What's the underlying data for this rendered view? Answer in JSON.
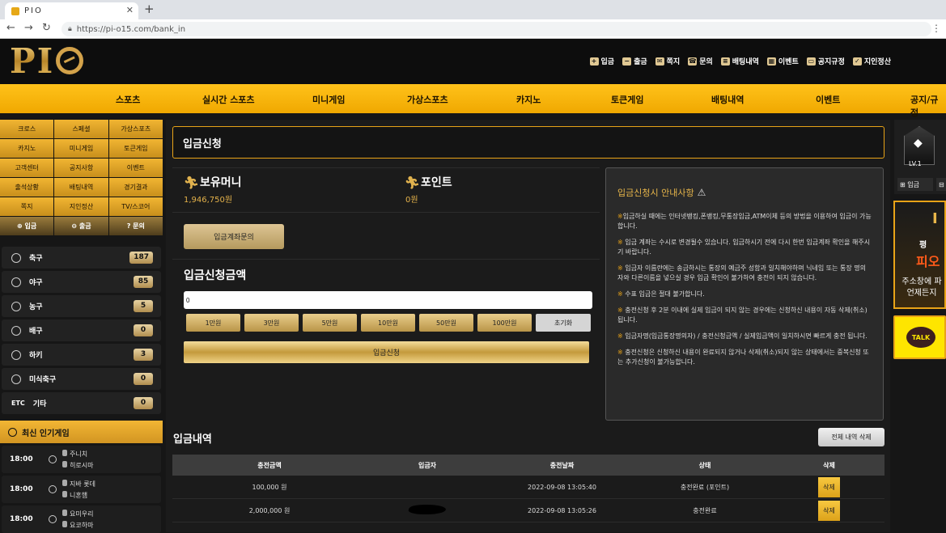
{
  "browser": {
    "tab_title": "PIO",
    "url": "https://pi-o15.com/bank_in"
  },
  "header": {
    "logo_text": "PI",
    "links": [
      "입금",
      "출금",
      "쪽지",
      "문의",
      "배팅내역",
      "이벤트",
      "공지규정",
      "지인정산"
    ]
  },
  "mainnav": {
    "items": [
      "스포츠",
      "실시간 스포츠",
      "미니게임",
      "가상스포츠",
      "카지노",
      "토큰게임",
      "배팅내역",
      "이벤트",
      "공지/규정"
    ]
  },
  "sidebar": {
    "grid": [
      "크로스",
      "스페셜",
      "가상스포츠",
      "카지노",
      "미니게임",
      "토큰게임",
      "고객센터",
      "공지사항",
      "이벤트",
      "출석상황",
      "배팅내역",
      "경기결과",
      "쪽지",
      "지인정산",
      "TV/스코어"
    ],
    "actions": [
      "입금",
      "출금",
      "문의"
    ],
    "sports": [
      {
        "name": "축구",
        "count": "187"
      },
      {
        "name": "야구",
        "count": "85"
      },
      {
        "name": "농구",
        "count": "5"
      },
      {
        "name": "배구",
        "count": "0"
      },
      {
        "name": "하키",
        "count": "3"
      },
      {
        "name": "미식축구",
        "count": "0"
      },
      {
        "name": "기타",
        "count": "0",
        "prefix": "ETC"
      }
    ],
    "popular_title": "최신 인기게임",
    "games": [
      {
        "time": "18:00",
        "team1": "주니치",
        "team2": "히로시마"
      },
      {
        "time": "18:00",
        "team1": "지바 롯데",
        "team2": "니혼햄"
      },
      {
        "time": "18:00",
        "team1": "요미우리",
        "team2": "요코하마"
      }
    ]
  },
  "page": {
    "title": "입금신청",
    "balance_label": "보유머니",
    "balance_value": "1,946,750원",
    "point_label": "포인트",
    "point_value": "0원",
    "account_button": "입금계좌문의",
    "amount_label": "입금신청금액",
    "amount_value": "0",
    "amount_buttons": [
      "1만원",
      "3만원",
      "5만원",
      "10만원",
      "50만원",
      "100만원"
    ],
    "reset_button": "초기화",
    "submit_button": "입금신청"
  },
  "notice": {
    "title": "입금신청시 안내사항",
    "items": [
      "입금하실 때에는 인터넷뱅킹,폰뱅킹,무통장입금,ATM이체 등의 방법을 이용하여 입금이 가능합니다.",
      "입금 계좌는 수시로 변경될수 있습니다. 입금하시기 전에 다시 한번 입금계좌 확인을 해주시기 바랍니다.",
      "입금자 이름란에는 송금하시는 통장의 예금주 성함과 일치해야하며 닉네임 또는 통장 명의자와 다른이름을 넣으실 경우 입금 확인이 불가하여 충전이 되지 않습니다.",
      "수표 입금은 절대 불가합니다.",
      "충전신청 후 2분 이내에 실제 입금이 되지 않는 경우에는 신청하신 내용이 자동 삭제(취소) 됩니다.",
      "입금자명(입금통장명의자) / 충전신청금액 / 실제입금액이 일치하시면 빠르게 충전 됩니다.",
      "충전신청은 신청하신 내용이 완료되지 않거나 삭제(취소)되지 않는 상태에서는 중복신청 또는 추가신청이 불가능합니다."
    ]
  },
  "history": {
    "title": "입금내역",
    "delete_all": "전체 내역 삭제",
    "columns": [
      "충전금액",
      "입금자",
      "충전날짜",
      "상태",
      "삭제"
    ],
    "rows": [
      {
        "amount": "100,000 원",
        "depositor": "",
        "date": "2022-09-08 13:05:40",
        "status": "충전완료 (포인트)",
        "action": "삭제"
      },
      {
        "amount": "2,000,000 원",
        "depositor": "",
        "date": "2022-09-08 13:05:26",
        "status": "충전완료",
        "action": "삭제"
      }
    ]
  },
  "right": {
    "level": "LV.1",
    "btn_deposit": "입금",
    "banner_top": "I",
    "banner_line1": "평",
    "banner_line2": "피오",
    "banner_line3": "주소창에 파\n언제든지",
    "kakao": "TALK"
  },
  "colors": {
    "accent": "#f0a800",
    "gold": "#e3b14a",
    "background": "#161616"
  }
}
